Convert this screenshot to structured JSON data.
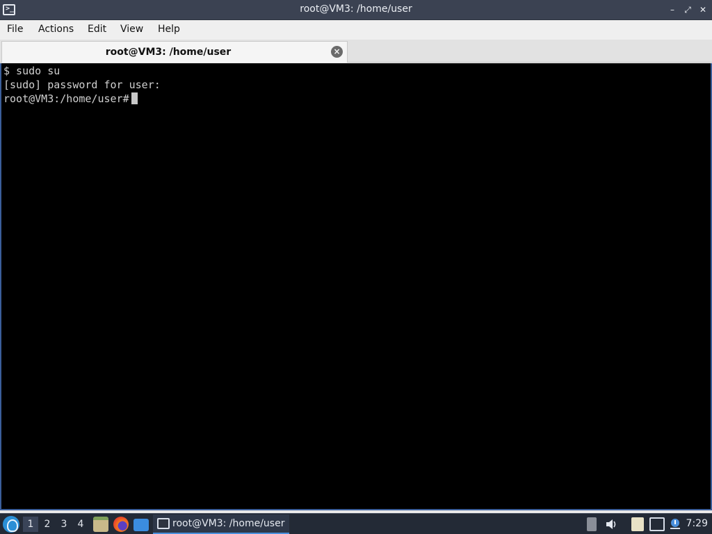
{
  "window": {
    "title": "root@VM3: /home/user",
    "controls": {
      "minimize": "–",
      "restore": "⤢",
      "close": "✕"
    }
  },
  "menu": [
    "File",
    "Actions",
    "Edit",
    "View",
    "Help"
  ],
  "tab": {
    "label": "root@VM3: /home/user",
    "close": "×"
  },
  "terminal": {
    "lines": [
      "$ sudo su",
      "[sudo] password for user:",
      "root@VM3:/home/user#"
    ]
  },
  "taskbar": {
    "workspaces": [
      "1",
      "2",
      "3",
      "4"
    ],
    "active_workspace": "1",
    "task_label": "root@VM3: /home/user",
    "clock": "7:29",
    "colors": {
      "accent": "#4a8fdc",
      "panel": "#232a36"
    }
  }
}
